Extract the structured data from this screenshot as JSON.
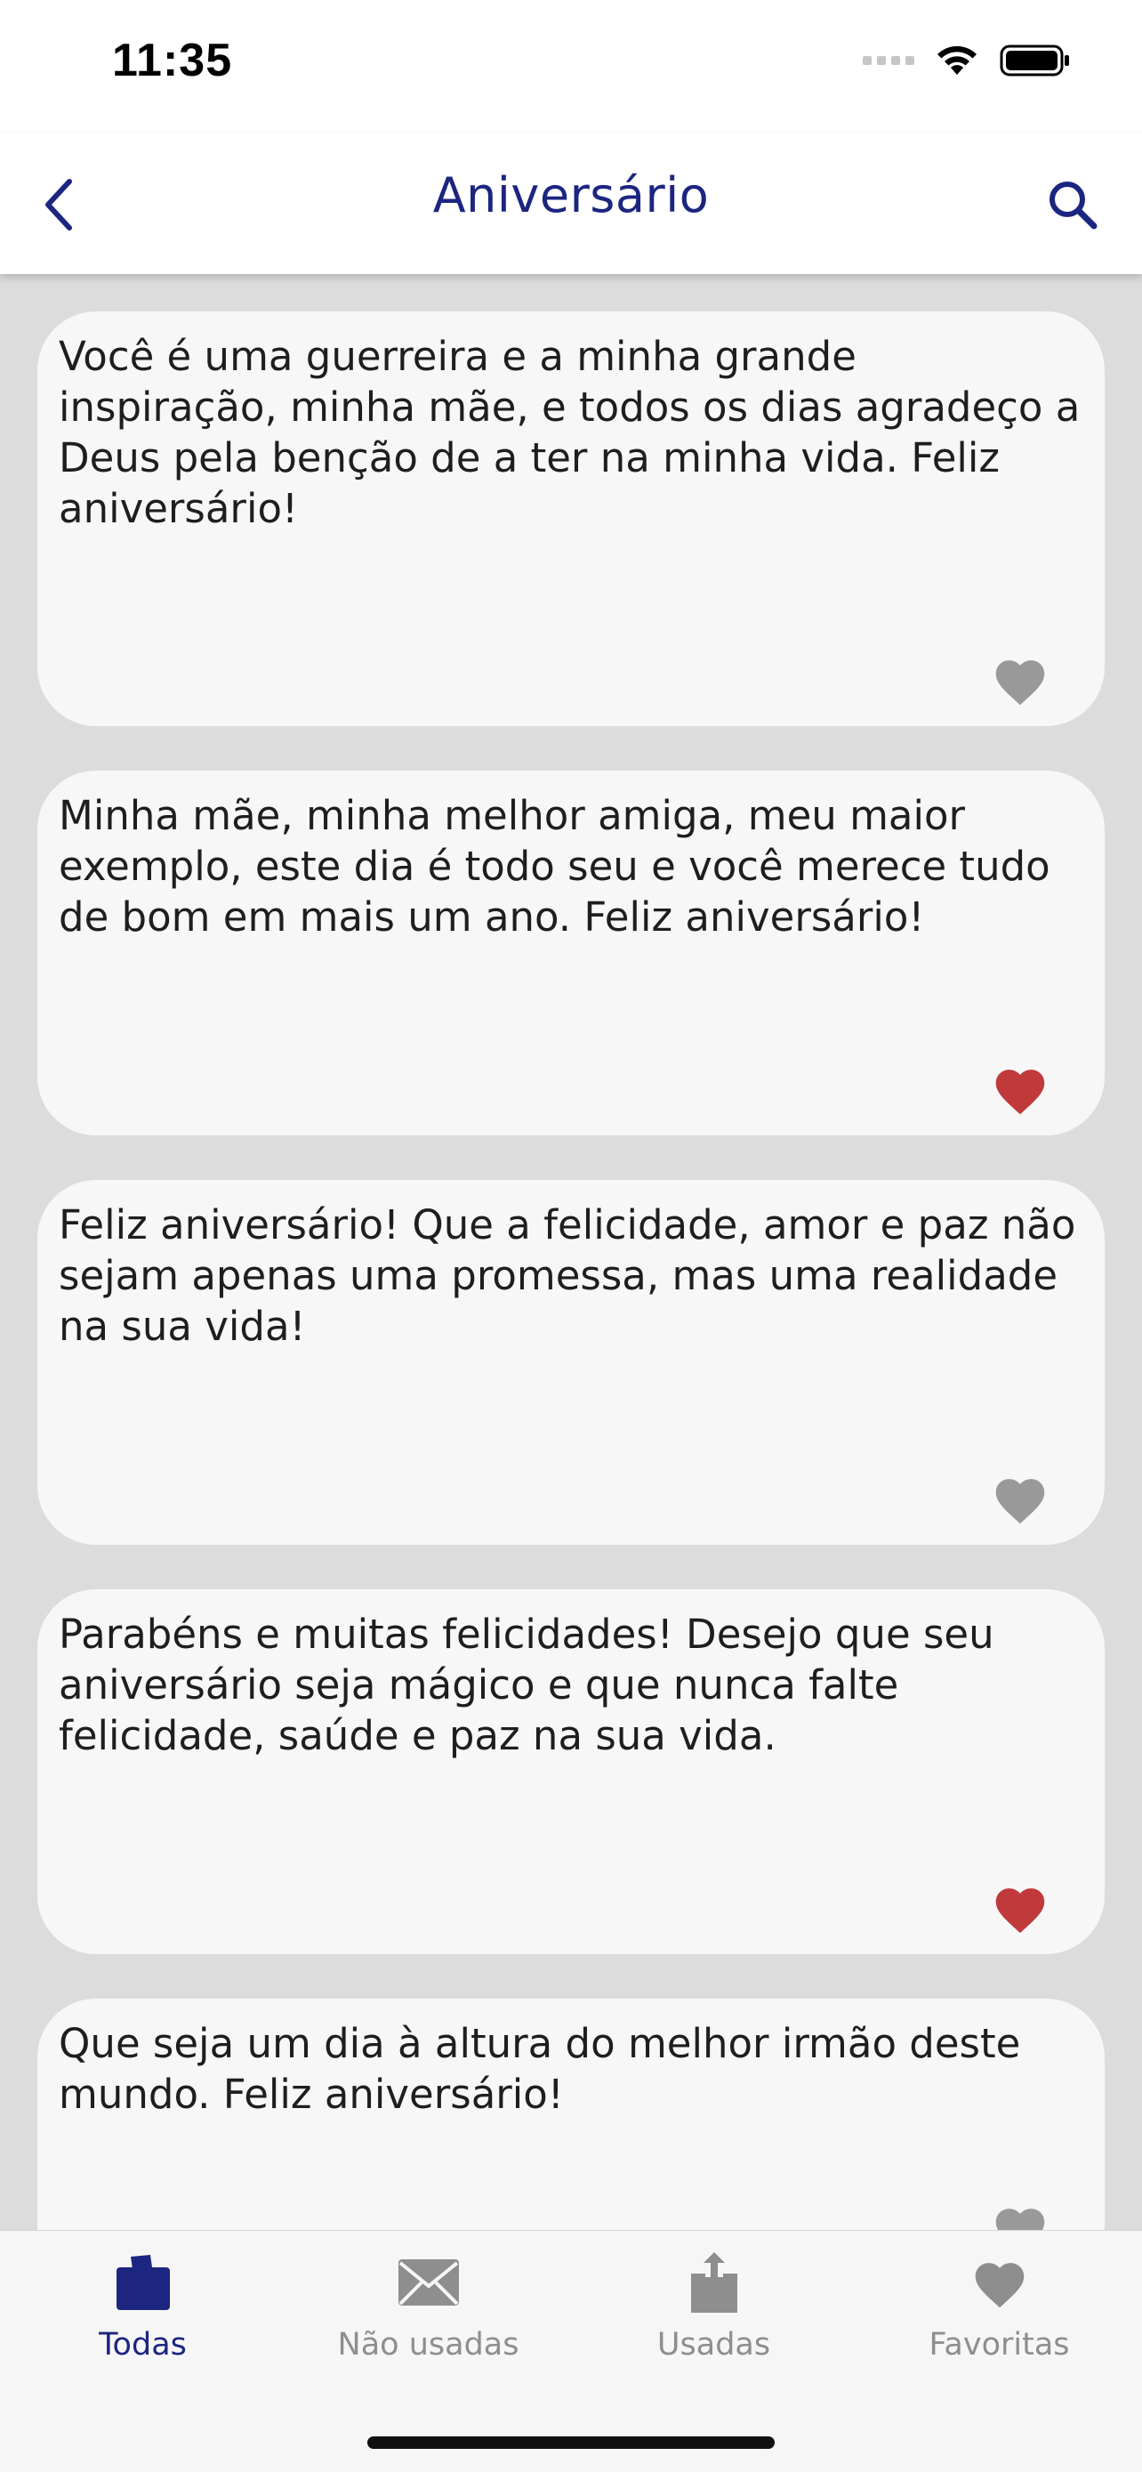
{
  "status": {
    "time": "11:35",
    "icons": [
      "signal-icon",
      "wifi-icon",
      "battery-icon"
    ]
  },
  "nav": {
    "title": "Aniversário",
    "back_icon": "chevron-left-icon",
    "search_icon": "search-icon"
  },
  "colors": {
    "accent": "#1c2580",
    "favorite": "#c0393b",
    "not_favorite": "#999999",
    "inactive_tab": "#8e8e8e"
  },
  "messages": [
    {
      "text": "Você é uma guerreira e a minha grande inspiração, minha mãe, e todos os dias agradeço a Deus pela benção de a ter na minha vida. Feliz aniversário!",
      "favorite": false
    },
    {
      "text": "Minha mãe, minha melhor amiga, meu maior exemplo, este dia é todo seu e você merece tudo de bom em mais um ano. Feliz aniversário!",
      "favorite": true
    },
    {
      "text": "Feliz aniversário! Que a felicidade, amor e paz não sejam apenas uma promessa, mas uma realidade na sua vida!",
      "favorite": false
    },
    {
      "text": "Parabéns e muitas felicidades! Desejo que seu aniversário seja mágico e que nunca falte felicidade, saúde e paz na sua vida.",
      "favorite": true
    },
    {
      "text": "Que seja um dia à altura do melhor irmão deste mundo. Feliz aniversário!",
      "favorite": false
    }
  ],
  "tabs": [
    {
      "label": "Todas",
      "icon": "folder-icon",
      "active": true
    },
    {
      "label": "Não usadas",
      "icon": "envelope-icon",
      "active": false
    },
    {
      "label": "Usadas",
      "icon": "share-icon",
      "active": false
    },
    {
      "label": "Favoritas",
      "icon": "heart-icon",
      "active": false
    }
  ]
}
